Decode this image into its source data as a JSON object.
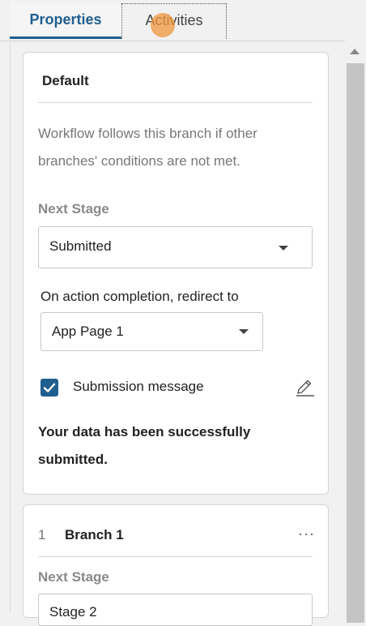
{
  "tabs": {
    "properties": "Properties",
    "activities": "Activities"
  },
  "default_branch": {
    "title": "Default",
    "description": "Workflow follows this branch if other branches' conditions are not met.",
    "next_stage_label": "Next Stage",
    "next_stage_value": "Submitted",
    "redirect_label": "On action completion, redirect to",
    "redirect_value": "App Page 1",
    "submission_checkbox_label": "Submission message",
    "submission_checked": true,
    "submission_message": "Your data has been successfully submitted."
  },
  "branch_1": {
    "number": "1",
    "title": "Branch 1",
    "more_label": "···",
    "next_stage_label": "Next Stage",
    "next_stage_value": "Stage 2"
  },
  "colors": {
    "accent": "#1f5f8f",
    "click_indicator": "#f0963c"
  }
}
